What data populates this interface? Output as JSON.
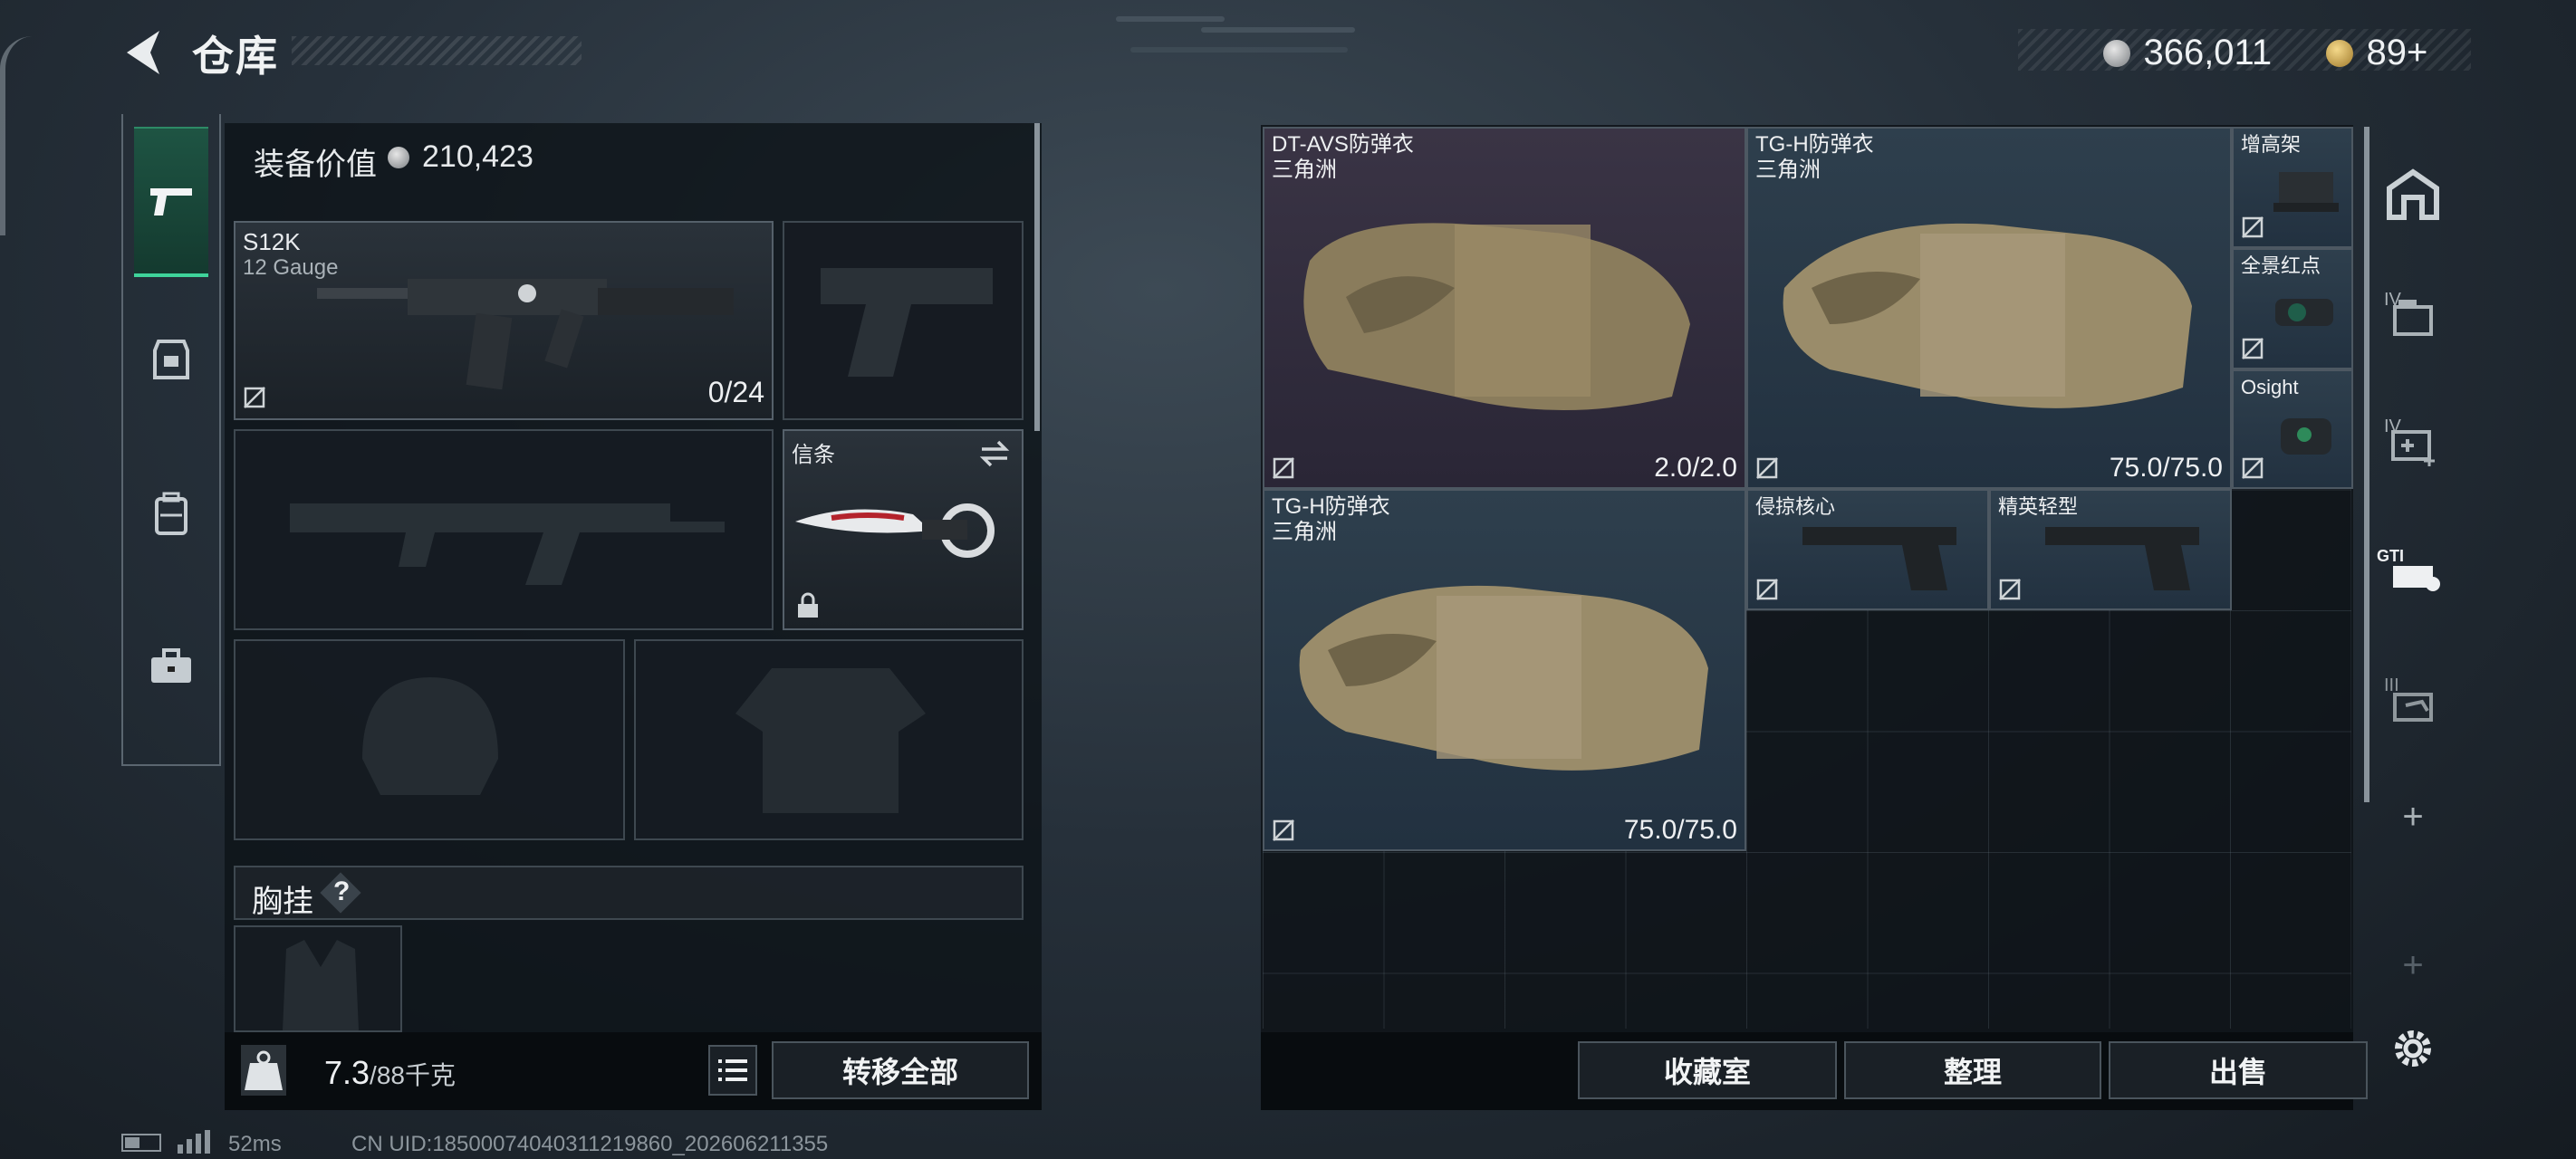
{
  "header": {
    "title": "仓库"
  },
  "currency": {
    "silver": "366,011",
    "gold": "89+"
  },
  "loadout": {
    "value_label": "装备价值",
    "value": "210,423"
  },
  "slots": {
    "primary": {
      "name": "S12K",
      "caliber": "12 Gauge",
      "ammo": "0/24"
    },
    "melee": {
      "name": "信条"
    }
  },
  "chest_rig": {
    "label": "胸挂",
    "help": "?"
  },
  "capacity": {
    "current": "7.3",
    "max": "/88千克",
    "icon_text": "KG"
  },
  "left_actions": {
    "transfer_all": "转移全部"
  },
  "items": [
    {
      "name": "DT-AVS防弹衣",
      "origin": "三角洲",
      "durability": "2.0/2.0",
      "rarity": "purple"
    },
    {
      "name": "TG-H防弹衣",
      "origin": "三角洲",
      "durability": "75.0/75.0",
      "rarity": "blue"
    },
    {
      "name": "增高架",
      "rarity": "blue"
    },
    {
      "name": "全景红点",
      "rarity": "blue"
    },
    {
      "name": "Osight",
      "rarity": "blue"
    },
    {
      "name": "TG-H防弹衣",
      "origin": "三角洲",
      "durability": "75.0/75.0",
      "rarity": "blue"
    },
    {
      "name": "侵掠核心",
      "rarity": "blue"
    },
    {
      "name": "精英轻型",
      "rarity": "blue"
    }
  ],
  "right_actions": {
    "collection": "收藏室",
    "sort": "整理",
    "sell": "出售"
  },
  "right_tabs": {
    "tab2_level": "IV",
    "tab3_level": "IV",
    "tab4_label": "GTI",
    "tab5_level": "III",
    "add": "+",
    "add2": "+"
  },
  "footer": {
    "ping": "52ms",
    "uid": "CN UID:1850007404031121986​0_202606211355"
  },
  "colors": {
    "accent_green": "#3fd39a",
    "rarity_purple": "#3a3445",
    "rarity_blue": "#2e3f4d"
  }
}
